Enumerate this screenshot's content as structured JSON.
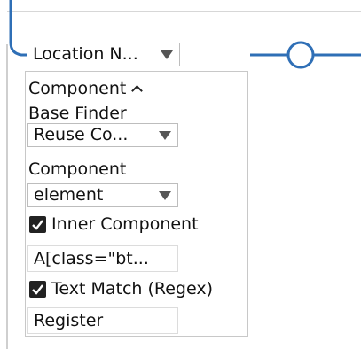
{
  "location_select": {
    "value": "Location N..."
  },
  "component_panel": {
    "header": "Component",
    "base_finder_label": "Base Finder",
    "base_finder_select": {
      "value": "Reuse Co..."
    },
    "component_label": "Component",
    "component_select": {
      "value": "element"
    },
    "inner_component": {
      "label": "Inner Component",
      "checked": true
    },
    "selector_input": {
      "value": "A[class=\"bt..."
    },
    "text_match": {
      "label": "Text Match (Regex)",
      "checked": true
    },
    "text_match_input": {
      "value": "Register"
    }
  },
  "colors": {
    "connector": "#2f6fb6",
    "border": "#c8c8c8",
    "checkbox": "#222222"
  },
  "icons": {
    "dropdown": "chevron-down-icon",
    "collapse": "chevron-up-icon",
    "check": "checkmark-icon",
    "node": "circle-node-icon"
  }
}
